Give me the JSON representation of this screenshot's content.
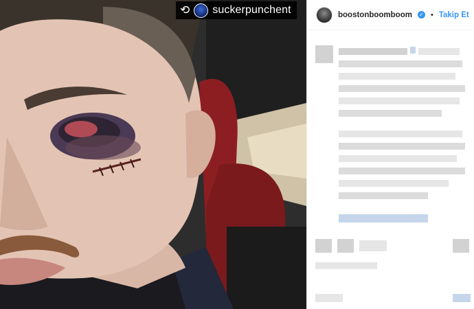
{
  "photo": {
    "repost": {
      "icon": "repost-icon",
      "username": "suckerpunchent"
    }
  },
  "post": {
    "author": "boostonboomboom",
    "verified": true,
    "separator": "•",
    "follow_label": "Takip Et"
  },
  "colors": {
    "accent": "#3897f0",
    "text": "#262626",
    "divider": "#efefef"
  }
}
